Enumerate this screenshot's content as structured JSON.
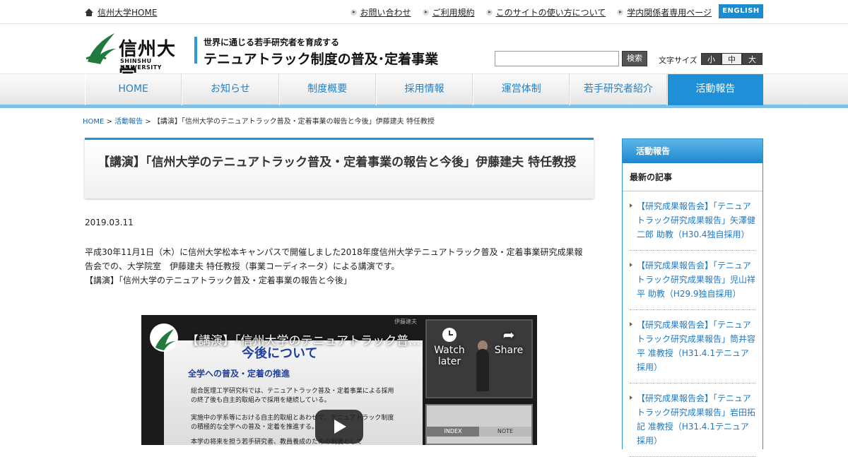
{
  "topbar": {
    "home_label": "信州大学HOME",
    "links": [
      "お問い合わせ",
      "ご利用規約",
      "このサイトの使い方について",
      "学内関係者専用ページ"
    ],
    "english_label": "ENGLISH"
  },
  "header": {
    "logo_ja": "信州大学",
    "logo_en": "SHINSHU UNIVERSITY",
    "tagline": "世界に通じる若手研究者を育成する",
    "title": "テニュアトラック制度の普及･定着事業",
    "search_placeholder": "",
    "search_button": "検索",
    "font_size_label": "文字サイズ",
    "font_sizes": [
      "小",
      "中",
      "大"
    ],
    "font_size_selected": "中"
  },
  "nav": {
    "items": [
      "HOME",
      "お知らせ",
      "制度概要",
      "採用情報",
      "運営体制",
      "若手研究者紹介",
      "活動報告"
    ],
    "active": "活動報告"
  },
  "breadcrumb": {
    "home": "HOME",
    "section": "活動報告",
    "current": "【講演】「信州大学のテニュアトラック普及・定着事業の報告と今後」伊藤建夫 特任教授",
    "sep": ">"
  },
  "article": {
    "title": "【講演】「信州大学のテニュアトラック普及・定着事業の報告と今後」伊藤建夫 特任教授",
    "date": "2019.03.11",
    "body_line1": "平成30年11月1日（木）に信州大学松本キャンパスで開催しました2018年度信州大学テニュアトラック普及・定着事業研究成果報告会での、大学院室　伊藤建夫 特任教授（事業コーディネータ）による講演です。",
    "body_line2": "【講演】「信州大学のテニュアトラック普及・定着事業の報告と今後」"
  },
  "video": {
    "title": "【講演】「信州大学のテニュアトラック普及・定着事業の報告と今後」",
    "speaker": "伊藤建夫",
    "watch_later": "Watch later",
    "share": "Share",
    "slide_heading": "今後について",
    "slide_subheading": "全学への普及・定着の推進",
    "slide_para1": "総合医理工学研究科では、テニュアトラック普及・定着事業による採用の終了後も自主的取組みで採用を継続している。",
    "slide_para2": "実施中の学系等における自主的取組とあわせて、テニュアトラック制度の積極的な全学への普及・定着を推進する。",
    "slide_para3": "本学の将来を担う若手研究者、教員養成のための制度として",
    "index_label": "INDEX",
    "note_label": "NOTE"
  },
  "sidebar": {
    "heading": "活動報告",
    "subheading": "最新の記事",
    "items": [
      "【研究成果報告会】「テニュアトラック研究成果報告」矢澤健二郎 助教（H30.4独自採用）",
      "【研究成果報告会】「テニュアトラック研究成果報告」児山祥平 助教（H29.9独自採用）",
      "【研究成果報告会】「テニュアトラック研究成果報告」筒井容平 准教授（H31.4.1テニュア採用）",
      "【研究成果報告会】「テニュアトラック研究成果報告」岩田拓記 准教授（H31.4.1テニュア採用）"
    ]
  },
  "colors": {
    "accent": "#1f90d8",
    "link": "#1f78c2",
    "logo_green": "#1f7a3c"
  }
}
